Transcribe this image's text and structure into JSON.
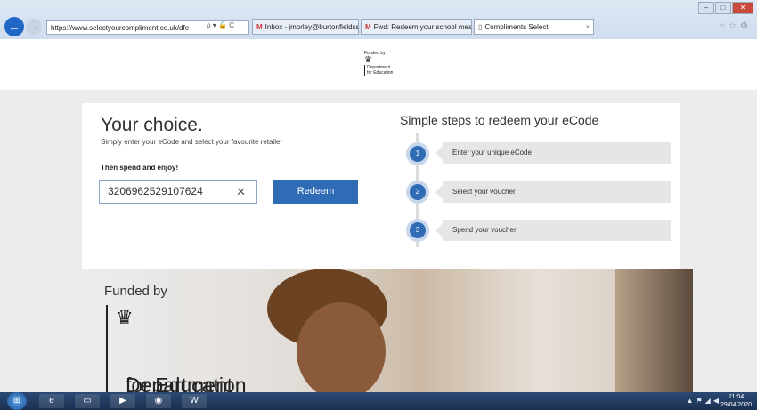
{
  "browser": {
    "address_url": "https://www.selectyourcompliment.co.uk/dfe",
    "address_tools": "ρ ▾ 🔒 C",
    "tabs": [
      {
        "label": "Inbox - jmorley@burtonfieldss..."
      },
      {
        "label": "Fwd: Redeem your school mea..."
      },
      {
        "label": "Compliments Select",
        "active": true
      }
    ]
  },
  "header": {
    "logo_funded": "Funded by",
    "logo_line1": "Department",
    "logo_line2": "for Education"
  },
  "choice": {
    "title": "Your choice.",
    "subtitle": "Simply enter your eCode and select your favourite retailer",
    "spend": "Then spend and enjoy!",
    "ecode_value": "3206962529107624",
    "clear_glyph": "✕",
    "redeem_label": "Redeem"
  },
  "steps": {
    "title": "Simple steps to redeem your eCode",
    "items": [
      {
        "num": "1",
        "label": "Enter your unique eCode"
      },
      {
        "num": "2",
        "label": "Select your voucher"
      },
      {
        "num": "3",
        "label": "Spend your voucher"
      }
    ]
  },
  "hero": {
    "funded": "Funded by",
    "dept_line1": "Department",
    "dept_line2": "for Education"
  },
  "taskbar": {
    "time": "21:04",
    "date": "29/04/2020"
  }
}
